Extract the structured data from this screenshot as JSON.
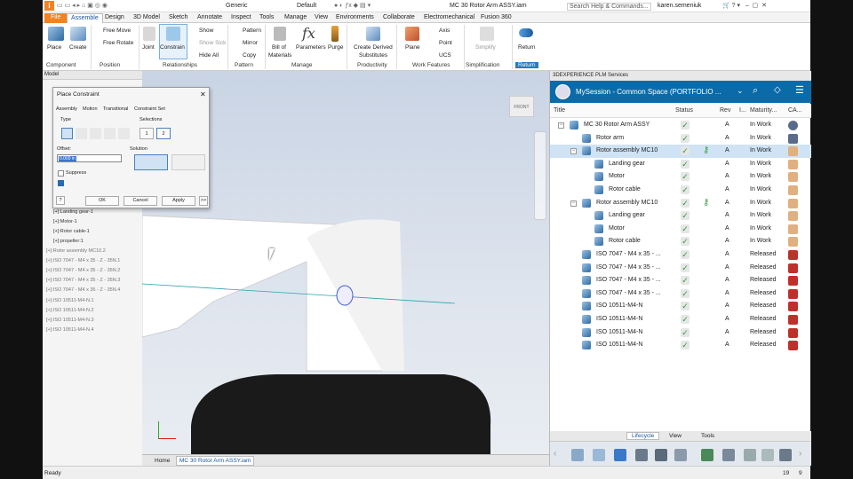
{
  "titlebar": {
    "workspace": "Generic",
    "style": "Default",
    "filename": "MC 30 Rotor Arm ASSY.iam",
    "search_placeholder": "Search Help & Commands...",
    "user": "karen.semeniuk"
  },
  "tabs": [
    "File",
    "Assemble",
    "Design",
    "3D Model",
    "Sketch",
    "Annotate",
    "Inspect",
    "Tools",
    "Manage",
    "View",
    "Environments",
    "Collaborate",
    "Electromechanical",
    "Fusion 360"
  ],
  "ribbon": {
    "place": "Place",
    "create": "Create",
    "free_move": "Free Move",
    "free_rotate": "Free Rotate",
    "joint": "Joint",
    "constrain": "Constrain",
    "show": "Show",
    "show_sick": "Show Sick",
    "hide_all": "Hide All",
    "pattern": "Pattern",
    "mirror": "Mirror",
    "copy": "Copy",
    "bill_of": "Bill of",
    "materials": "Materials",
    "parameters": "Parameters",
    "purge": "Purge",
    "create_derived": "Create Derived",
    "substitutes": "Substitutes",
    "plane": "Plane",
    "axis": "Axis",
    "point": "Point",
    "ucs": "UCS",
    "simplify": "Simplify",
    "return": "Return",
    "groups": [
      "Component",
      "Position",
      "Relationships",
      "Pattern",
      "Manage",
      "Productivity",
      "Work Features",
      "Simplification",
      "Return"
    ]
  },
  "browser": {
    "tab": "Model",
    "items": [
      "[+]:Landing gear-1",
      "[+]:Motor-1",
      "[+]:Rotor cable-1",
      "[+]:propeller:1",
      "[+]:Rotor assembly MC10.2",
      "[+]:ISO 7047 - M4 x 35 - Z - 35N.1",
      "[+]:ISO 7047 - M4 x 35 - Z - 35N.2",
      "[+]:ISO 7047 - M4 x 35 - Z - 35N.3",
      "[+]:ISO 7047 - M4 x 35 - Z - 35N.4",
      "[+]:ISO 10511-M4-N.1",
      "[+]:ISO 10511-M4-N.2",
      "[+]:ISO 10511-M4-N.3",
      "[+]:ISO 10511-M4-N.4"
    ]
  },
  "dialog": {
    "title": "Place Constraint",
    "tabs": [
      "Assembly",
      "Motion",
      "Transitional",
      "Constraint Set"
    ],
    "type": "Type",
    "selections": "Selections",
    "offset": "Offset:",
    "offset_value": "0.000 in",
    "solution": "Solution",
    "suppress": "Suppress",
    "ok": "OK",
    "cancel": "Cancel",
    "apply": "Apply",
    "more": ">>",
    "sel1": "1",
    "sel2": "2"
  },
  "viewcube": "FRONT",
  "doctabs": {
    "home": "Home",
    "doc": "MC 30 Rotor Arm ASSY.iam"
  },
  "status": {
    "text": "Ready",
    "n1": "19",
    "n2": "9"
  },
  "plm": {
    "panel_title": "3DEXPERIENCE PLM Services",
    "session": "MySession - Common Space (PORTFOLIO ...",
    "columns": [
      "Title",
      "Status",
      "Rev",
      "I...",
      "Maturity...",
      "CA..."
    ],
    "rows": [
      {
        "title": "MC 30 Rotor Arm ASSY",
        "rev": "A",
        "mat": "In Work"
      },
      {
        "title": "Rotor arm",
        "rev": "A",
        "mat": "In Work"
      },
      {
        "title": "Rotor assembly MC10",
        "rev": "A",
        "mat": "In Work"
      },
      {
        "title": "Landing gear",
        "rev": "A",
        "mat": "In Work"
      },
      {
        "title": "Motor",
        "rev": "A",
        "mat": "In Work"
      },
      {
        "title": "Rotor cable",
        "rev": "A",
        "mat": "In Work"
      },
      {
        "title": "Rotor assembly MC10",
        "rev": "A",
        "mat": "In Work"
      },
      {
        "title": "Landing gear",
        "rev": "A",
        "mat": "In Work"
      },
      {
        "title": "Motor",
        "rev": "A",
        "mat": "In Work"
      },
      {
        "title": "Rotor cable",
        "rev": "A",
        "mat": "In Work"
      },
      {
        "title": "ISO 7047 - M4 x 35 - ...",
        "rev": "A",
        "mat": "Released"
      },
      {
        "title": "ISO 7047 - M4 x 35 - ...",
        "rev": "A",
        "mat": "Released"
      },
      {
        "title": "ISO 7047 - M4 x 35 - ...",
        "rev": "A",
        "mat": "Released"
      },
      {
        "title": "ISO 7047 - M4 x 35 - ...",
        "rev": "A",
        "mat": "Released"
      },
      {
        "title": "ISO 10511-M4-N",
        "rev": "A",
        "mat": "Released"
      },
      {
        "title": "ISO 10511-M4-N",
        "rev": "A",
        "mat": "Released"
      },
      {
        "title": "ISO 10511-M4-N",
        "rev": "A",
        "mat": "Released"
      },
      {
        "title": "ISO 10511-M4-N",
        "rev": "A",
        "mat": "Released"
      }
    ],
    "bottom_tabs": [
      "Lifecycle",
      "View",
      "Tools"
    ]
  },
  "colors": {
    "brand": "#f5821f",
    "plm_header": "#0a6ba8",
    "selection": "#cfe3f5",
    "check": "#2b9a3e"
  }
}
